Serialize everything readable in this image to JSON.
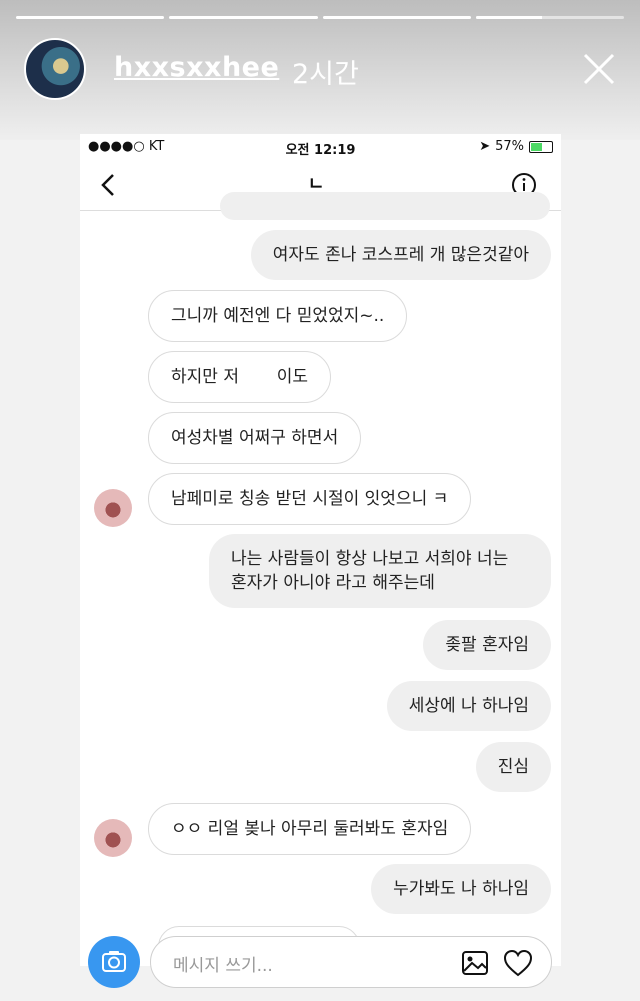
{
  "story": {
    "progress": [
      1,
      1,
      1,
      0.45
    ],
    "username": "hxxsxxhee",
    "time_ago": "2시간"
  },
  "screenshot": {
    "status": {
      "carrier": "●●●●○ KT",
      "time": "오전 12:19",
      "battery": "57%",
      "battery_level": 0.57
    },
    "chat_title": "ㄴ_",
    "messages": [
      {
        "side": "sent",
        "text": "여자도 존나 코스프레 개 많은것같아"
      },
      {
        "side": "recv",
        "text": "그니까 예전엔 다 믿었었지~.."
      },
      {
        "side": "recv",
        "text": "하지만 저       이도"
      },
      {
        "side": "recv",
        "text": "여성차별 어쩌구 하면서"
      },
      {
        "side": "recv",
        "text": "남페미로 칭송 받던 시절이 잇엇으니 ㅋ"
      },
      {
        "side": "sent",
        "text": "나는 사람들이 항상 나보고 서희야 너는 혼자가 아니야 라고 해주는데"
      },
      {
        "side": "sent",
        "text": "좆팔 혼자임"
      },
      {
        "side": "sent",
        "text": "세상에 나 하나임"
      },
      {
        "side": "sent",
        "text": "진심"
      },
      {
        "side": "recv",
        "text": "ㅇㅇ 리얼 봊나 아무리 둘러봐도 혼자임"
      },
      {
        "side": "sent",
        "text": "누가봐도 나 하나임"
      }
    ]
  },
  "reply": {
    "placeholder": "메시지 쓰기..."
  },
  "colors": {
    "accent": "#3897f0",
    "battery": "#4cd964"
  }
}
